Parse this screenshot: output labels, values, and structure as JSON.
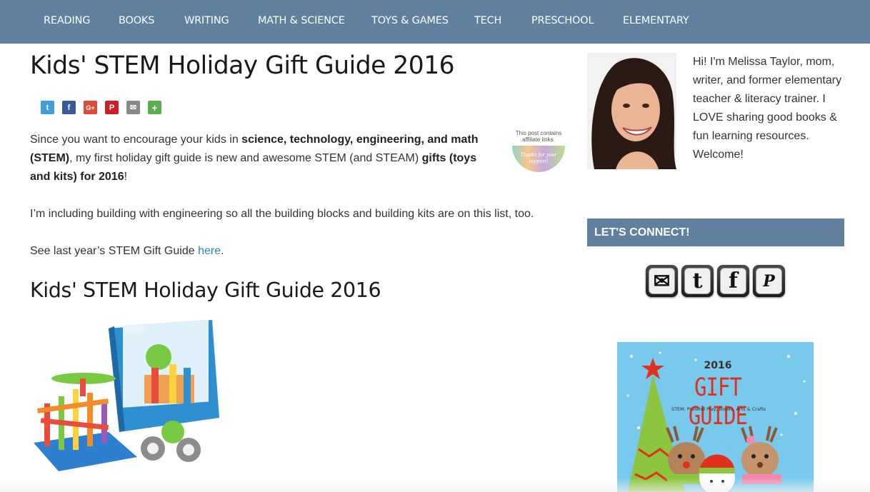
{
  "nav": {
    "items": [
      "READING",
      "BOOKS",
      "WRITING",
      "MATH & SCIENCE",
      "TOYS & GAMES",
      "TECH",
      "PRESCHOOL",
      "ELEMENTARY"
    ]
  },
  "post": {
    "title": "Kids' STEM Holiday Gift Guide 2016",
    "share": [
      {
        "name": "twitter",
        "glyph": "t",
        "color": "#3f9fd8"
      },
      {
        "name": "facebook",
        "glyph": "f",
        "color": "#3b5998"
      },
      {
        "name": "google-plus",
        "glyph": "G+",
        "color": "#dd4b39"
      },
      {
        "name": "pinterest",
        "glyph": "P",
        "color": "#cb2027"
      },
      {
        "name": "email",
        "glyph": "✉",
        "color": "#888888"
      },
      {
        "name": "more",
        "glyph": "+",
        "color": "#5bae4e"
      }
    ],
    "intro": {
      "p1": "Since you want to encourage your kids in ",
      "b1": "science, technology, engineering, and math (STEM)",
      "p2": ", my first holiday gift guide is new and awesome STEM (and STEAM) ",
      "b2": "gifts (toys and kits) for 2016",
      "p3": "!"
    },
    "para2": "I’m including building with engineering so all the building blocks and building kits are on this list, too.",
    "para3": {
      "before": "See last year’s STEM Gift Guide ",
      "link": "here",
      "after": "."
    },
    "section_title": "Kids' STEM Holiday Gift Guide 2016",
    "badge": {
      "text": "This post contains affiliate links.",
      "script": "Thanks for your support!"
    }
  },
  "sidebar": {
    "bio": "Hi! I'm Melissa Taylor, mom, writer, and former elementary teacher & literacy trainer. I LOVE sharing good books & fun learning resources. Welcome!",
    "connect_title": "LET'S CONNECT!",
    "social": [
      {
        "name": "email",
        "glyph": "✉"
      },
      {
        "name": "twitter",
        "glyph": "t"
      },
      {
        "name": "facebook",
        "glyph": "f"
      },
      {
        "name": "pinterest",
        "glyph": "P"
      }
    ],
    "ad": {
      "year": "2016",
      "title": "GIFT GUIDE",
      "subtitle": "STEM, Pretend Play, Books, Arts & Crafts"
    }
  }
}
